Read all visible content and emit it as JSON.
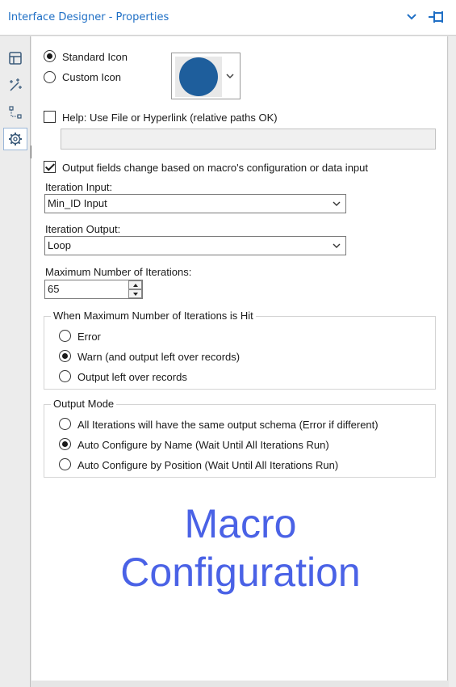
{
  "window": {
    "title": "Interface Designer - Properties"
  },
  "icons": {
    "title_chevron": "chevron-down-icon",
    "title_pin": "pin-icon",
    "sidebar": [
      "layout-icon",
      "wand-icon",
      "tree-icon",
      "gear-icon"
    ]
  },
  "icon_choice": {
    "standard_label": "Standard Icon",
    "custom_label": "Custom Icon",
    "selected": "Standard Icon",
    "swatch_color": "#1e5e9c"
  },
  "help": {
    "label": "Help: Use File or Hyperlink (relative paths OK)",
    "checked": false,
    "value": ""
  },
  "output_fields": {
    "label": "Output fields change based on macro's configuration or data input",
    "checked": true
  },
  "iteration_input": {
    "label": "Iteration Input:",
    "value": "Min_ID Input"
  },
  "iteration_output": {
    "label": "Iteration Output:",
    "value": "Loop"
  },
  "max_iterations": {
    "label": "Maximum Number of Iterations:",
    "value": "65"
  },
  "max_hit_group": {
    "legend": "When Maximum Number of Iterations is Hit",
    "options": [
      "Error",
      "Warn (and output left over records)",
      "Output left over records"
    ],
    "selected": "Warn (and output left over records)"
  },
  "output_mode_group": {
    "legend": "Output Mode",
    "options": [
      "All Iterations will have the same output schema (Error if different)",
      "Auto Configure by Name (Wait Until All Iterations Run)",
      "Auto Configure by Position (Wait Until All Iterations Run)"
    ],
    "selected": "Auto Configure by Name (Wait Until All Iterations Run)"
  },
  "overlay": {
    "line1": "Macro",
    "line2": "Configuration",
    "color": "#4a62e6"
  }
}
